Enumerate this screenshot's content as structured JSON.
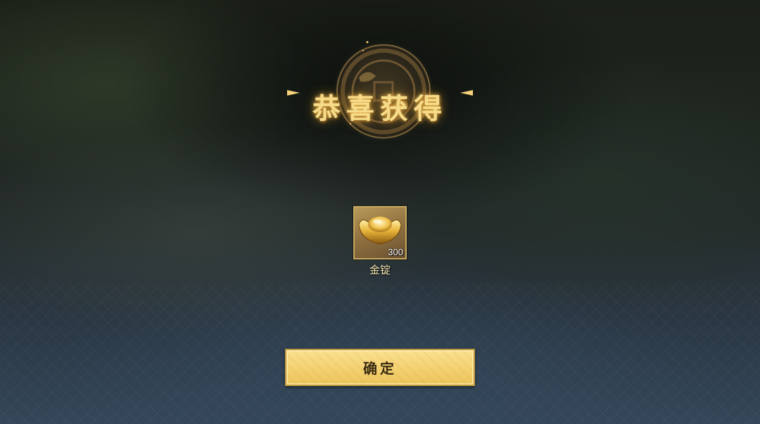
{
  "dialog": {
    "title": "恭喜获得"
  },
  "rewards": [
    {
      "name": "金锭",
      "count": "300",
      "icon": "gold-ingot-icon"
    }
  ],
  "buttons": {
    "confirm_label": "确定"
  },
  "colors": {
    "title_gold": "#f6dc8a",
    "button_fill": "#f4d170",
    "button_border": "#c19c3e",
    "item_frame": "#c7a861",
    "item_name": "#f3e3b0"
  }
}
